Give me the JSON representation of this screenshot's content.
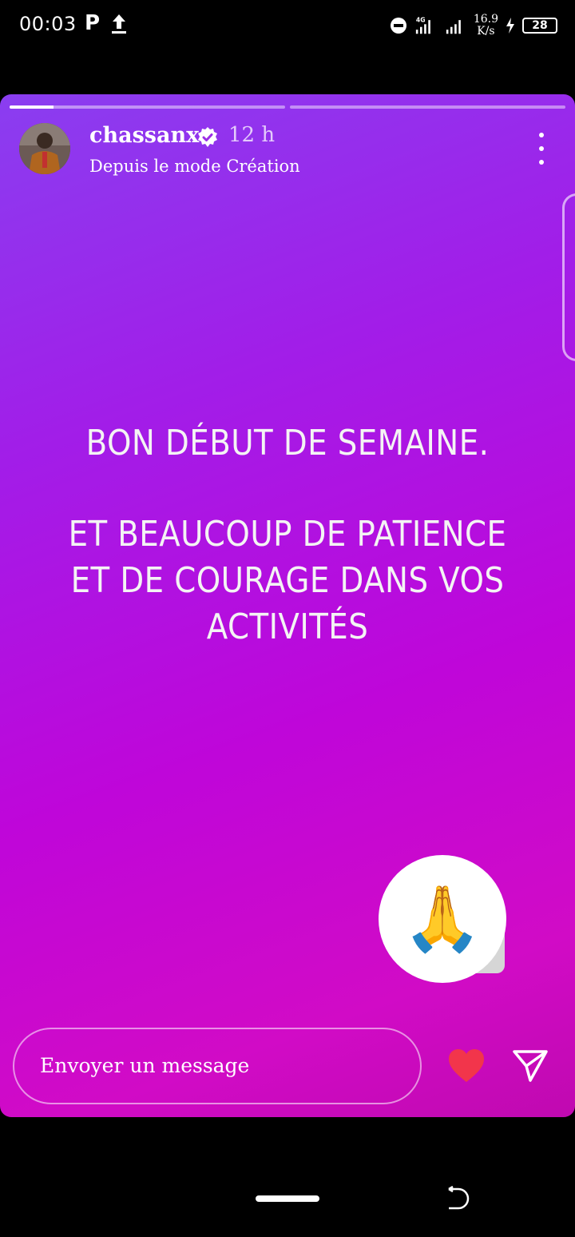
{
  "status_bar": {
    "time": "00:03",
    "p_label": "P",
    "network": "4G",
    "speed_value": "16.9",
    "speed_unit": "K/s",
    "battery": "28"
  },
  "story": {
    "progress": [
      0.16,
      0
    ],
    "username": "chassanx",
    "time_ago": "12 h",
    "subtitle": "Depuis le mode Création",
    "line1": "BON DÉBUT DE SEMAINE.",
    "para2_l1": "ET BEAUCOUP DE PATIENCE",
    "para2_l2": "ET DE COURAGE DANS VOS",
    "para2_l3": "ACTIVITÉS",
    "sticker_emoji": "🙏"
  },
  "footer": {
    "message_placeholder": "Envoyer un message"
  },
  "colors": {
    "gradient_start": "#8a3ef0",
    "gradient_end": "#c009b0",
    "heart": "#f2354b",
    "verified_badge": "#ffffff"
  }
}
